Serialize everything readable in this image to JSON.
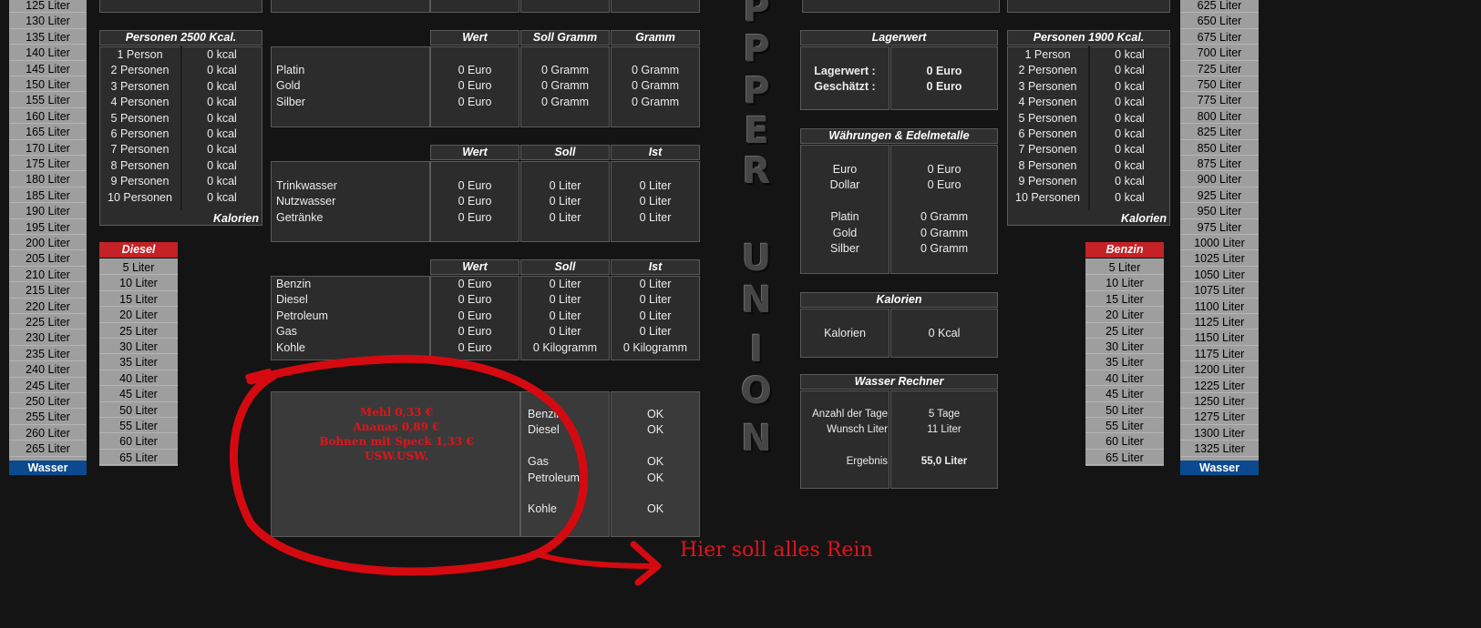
{
  "water_left": {
    "items": [
      "125 Liter",
      "130 Liter",
      "135 Liter",
      "140 Liter",
      "145 Liter",
      "150 Liter",
      "155 Liter",
      "160 Liter",
      "165 Liter",
      "170 Liter",
      "175 Liter",
      "180 Liter",
      "185 Liter",
      "190 Liter",
      "195 Liter",
      "200 Liter",
      "205 Liter",
      "210 Liter",
      "215 Liter",
      "220 Liter",
      "225 Liter",
      "230 Liter",
      "235 Liter",
      "240 Liter",
      "245 Liter",
      "250 Liter",
      "255 Liter",
      "260 Liter",
      "265 Liter"
    ],
    "footer": "Wasser"
  },
  "water_right": {
    "items": [
      "625 Liter",
      "650 Liter",
      "675 Liter",
      "700 Liter",
      "725 Liter",
      "750 Liter",
      "775 Liter",
      "800 Liter",
      "825 Liter",
      "850 Liter",
      "875 Liter",
      "900 Liter",
      "925 Liter",
      "950 Liter",
      "975 Liter",
      "1000 Liter",
      "1025 Liter",
      "1050 Liter",
      "1075 Liter",
      "1100 Liter",
      "1125 Liter",
      "1150 Liter",
      "1175 Liter",
      "1200 Liter",
      "1225 Liter",
      "1250 Liter",
      "1275 Liter",
      "1300 Liter",
      "1325 Liter"
    ],
    "footer": "Wasser"
  },
  "persons_left": {
    "title": "Personen 2500 Kcal.",
    "rows": [
      [
        "1 Person",
        "0 kcal"
      ],
      [
        "2 Personen",
        "0 kcal"
      ],
      [
        "3 Personen",
        "0 kcal"
      ],
      [
        "4 Personen",
        "0 kcal"
      ],
      [
        "5 Personen",
        "0 kcal"
      ],
      [
        "6 Personen",
        "0 kcal"
      ],
      [
        "7 Personen",
        "0 kcal"
      ],
      [
        "8 Personen",
        "0 kcal"
      ],
      [
        "9 Personen",
        "0 kcal"
      ],
      [
        "10 Personen",
        "0 kcal"
      ]
    ],
    "footer": "Kalorien"
  },
  "persons_right": {
    "title": "Personen 1900 Kcal.",
    "rows": [
      [
        "1 Person",
        "0 kcal"
      ],
      [
        "2 Personen",
        "0 kcal"
      ],
      [
        "3 Personen",
        "0 kcal"
      ],
      [
        "4 Personen",
        "0 kcal"
      ],
      [
        "5 Personen",
        "0 kcal"
      ],
      [
        "6 Personen",
        "0 kcal"
      ],
      [
        "7 Personen",
        "0 kcal"
      ],
      [
        "8 Personen",
        "0 kcal"
      ],
      [
        "9 Personen",
        "0 kcal"
      ],
      [
        "10 Personen",
        "0 kcal"
      ]
    ],
    "footer": "Kalorien"
  },
  "diesel": {
    "title": "Diesel",
    "items": [
      "5 Liter",
      "10 Liter",
      "15 Liter",
      "20 Liter",
      "25 Liter",
      "30 Liter",
      "35 Liter",
      "40 Liter",
      "45 Liter",
      "50 Liter",
      "55 Liter",
      "60 Liter",
      "65 Liter"
    ]
  },
  "benzin": {
    "title": "Benzin",
    "items": [
      "5 Liter",
      "10 Liter",
      "15 Liter",
      "20 Liter",
      "25 Liter",
      "30 Liter",
      "35 Liter",
      "40 Liter",
      "45 Liter",
      "50 Liter",
      "55 Liter",
      "60 Liter",
      "65 Liter"
    ]
  },
  "metals": {
    "headers": [
      "Wert",
      "Soll Gramm",
      "Gramm"
    ],
    "rows": [
      [
        "Platin",
        "0 Euro",
        "0 Gramm",
        "0 Gramm"
      ],
      [
        "Gold",
        "0 Euro",
        "0 Gramm",
        "0 Gramm"
      ],
      [
        "Silber",
        "0 Euro",
        "0 Gramm",
        "0 Gramm"
      ]
    ]
  },
  "water_table": {
    "headers": [
      "Wert",
      "Soll",
      "Ist"
    ],
    "rows": [
      [
        "Trinkwasser",
        "0 Euro",
        "0 Liter",
        "0 Liter"
      ],
      [
        "Nutzwasser",
        "0 Euro",
        "0 Liter",
        "0 Liter"
      ],
      [
        "Getränke",
        "0 Euro",
        "0 Liter",
        "0 Liter"
      ]
    ]
  },
  "fuel_table": {
    "headers": [
      "Wert",
      "Soll",
      "Ist"
    ],
    "rows": [
      [
        "Benzin",
        "0 Euro",
        "0 Liter",
        "0 Liter"
      ],
      [
        "Diesel",
        "0 Euro",
        "0 Liter",
        "0 Liter"
      ],
      [
        "Petroleum",
        "0 Euro",
        "0 Liter",
        "0 Liter"
      ],
      [
        "Gas",
        "0 Euro",
        "0 Liter",
        "0 Liter"
      ],
      [
        "Kohle",
        "0 Euro",
        "0 Kilogramm",
        "0 Kilogramm"
      ]
    ]
  },
  "status": {
    "items": [
      [
        "Benzin",
        "OK"
      ],
      [
        "Diesel",
        "OK"
      ],
      [
        "",
        ""
      ],
      [
        "Gas",
        "OK"
      ],
      [
        "Petroleum",
        "OK"
      ],
      [
        "",
        ""
      ],
      [
        "Kohle",
        "OK"
      ]
    ]
  },
  "annotation": {
    "lines": [
      "Mehl   0,33 €",
      "Ananas 0,89 €",
      "Bohnen mit Speck 1,33 €",
      "USW.USW."
    ],
    "arrow_text": "Hier soll alles Rein"
  },
  "lagerwert": {
    "title": "Lagerwert",
    "rows": [
      [
        "Lagerwert :",
        "0 Euro"
      ],
      [
        "Geschätzt :",
        "0 Euro"
      ]
    ]
  },
  "currencies": {
    "title": "Währungen & Edelmetalle",
    "rows": [
      [
        "Euro",
        "0 Euro"
      ],
      [
        "Dollar",
        "0 Euro"
      ],
      [
        "",
        ""
      ],
      [
        "Platin",
        "0 Gramm"
      ],
      [
        "Gold",
        "0 Gramm"
      ],
      [
        "Silber",
        "0 Gramm"
      ]
    ]
  },
  "calories": {
    "title": "Kalorien",
    "label": "Kalorien",
    "value": "0 Kcal"
  },
  "water_calc": {
    "title": "Wasser Rechner",
    "rows": [
      [
        "Anzahl der Tage",
        "5 Tage"
      ],
      [
        "Wunsch Liter",
        "11 Liter"
      ],
      [
        "",
        ""
      ],
      [
        "Ergebnis",
        "55,0 Liter"
      ]
    ]
  },
  "logo_letters": [
    "P",
    "P",
    "E",
    "R",
    "U",
    "N",
    "I",
    "O",
    "N"
  ]
}
